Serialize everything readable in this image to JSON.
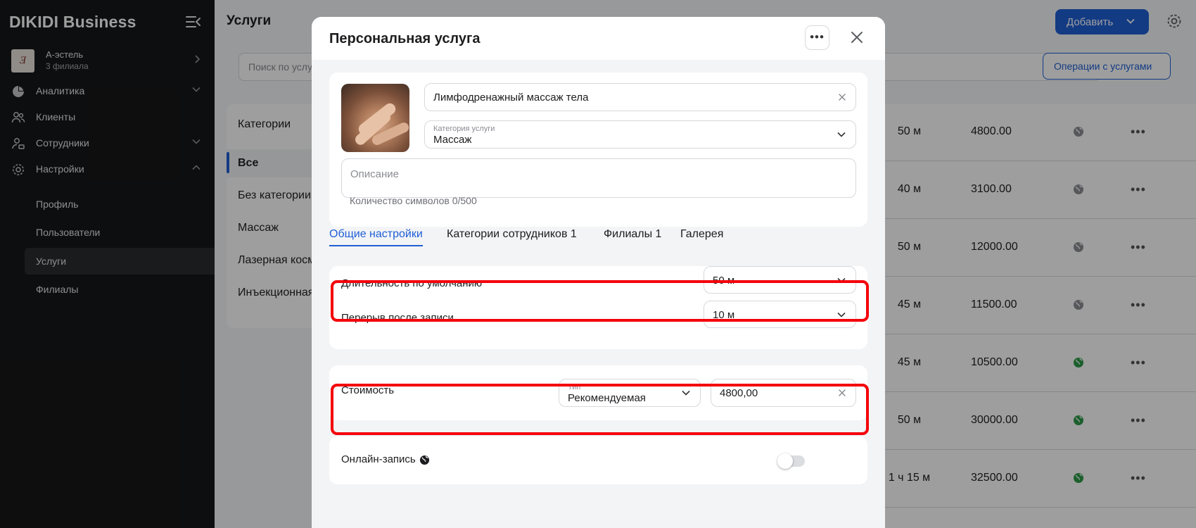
{
  "sidebar": {
    "brand": "DIKIDI Business",
    "branch": {
      "logo_text": "Ǝ",
      "name": "А-эстель",
      "subtitle": "3 филиала"
    },
    "nav": [
      {
        "label": "Аналитика",
        "icon": "pie-chart-icon"
      },
      {
        "label": "Клиенты",
        "icon": "users-icon"
      },
      {
        "label": "Сотрудники",
        "icon": "staff-icon"
      },
      {
        "label": "Настройки",
        "icon": "gear-icon"
      }
    ],
    "settings_sub": [
      "Профиль",
      "Пользователи",
      "Услуги",
      "Филиалы"
    ]
  },
  "main": {
    "title": "Услуги",
    "add_label": "Добавить",
    "search_placeholder": "Поиск по услугам",
    "ops_label": "Операции с услугами",
    "categories_title": "Категории",
    "categories": [
      "Все",
      "Без категории",
      "Массаж",
      "Лазерная косметология",
      "Инъекционная косметология"
    ],
    "rows": [
      {
        "duration": "50 м",
        "price": "4800.00",
        "online": false
      },
      {
        "duration": "40 м",
        "price": "3100.00",
        "online": false
      },
      {
        "duration": "50 м",
        "price": "12000.00",
        "online": false
      },
      {
        "duration": "45 м",
        "price": "11500.00",
        "online": false
      },
      {
        "duration": "45 м",
        "price": "10500.00",
        "online": true
      },
      {
        "duration": "50 м",
        "price": "30000.00",
        "online": true
      },
      {
        "duration": "1 ч 15 м",
        "price": "32500.00",
        "online": true
      }
    ],
    "more_glyph": "•••"
  },
  "modal": {
    "title": "Персональная услуга",
    "more_glyph": "•••",
    "service_name": "Лимфодренажный массаж тела",
    "category_caption": "Категория услуги",
    "category_value": "Массаж",
    "description_placeholder": "Описание",
    "char_counter": "Количество символов 0/500",
    "tabs": [
      "Общие настройки",
      "Категории сотрудников 1",
      "Филиалы 1",
      "Галерея"
    ],
    "active_tab": "Общие настройки",
    "duration_label": "Длительность по умолчанию",
    "duration_value": "50 м",
    "break_label": "Перерыв после записи",
    "break_value": "10 м",
    "cost_label": "Стоимость",
    "cost_type_caption": "Тип",
    "cost_type_value": "Рекомендуемая",
    "cost_value": "4800,00",
    "online_label": "Онлайн-запись",
    "online_enabled": false
  },
  "colors": {
    "accent": "#1f5fd6",
    "highlight": "#f4020b",
    "sidebar": "#161719",
    "online_globe": "#2e9b4a"
  }
}
